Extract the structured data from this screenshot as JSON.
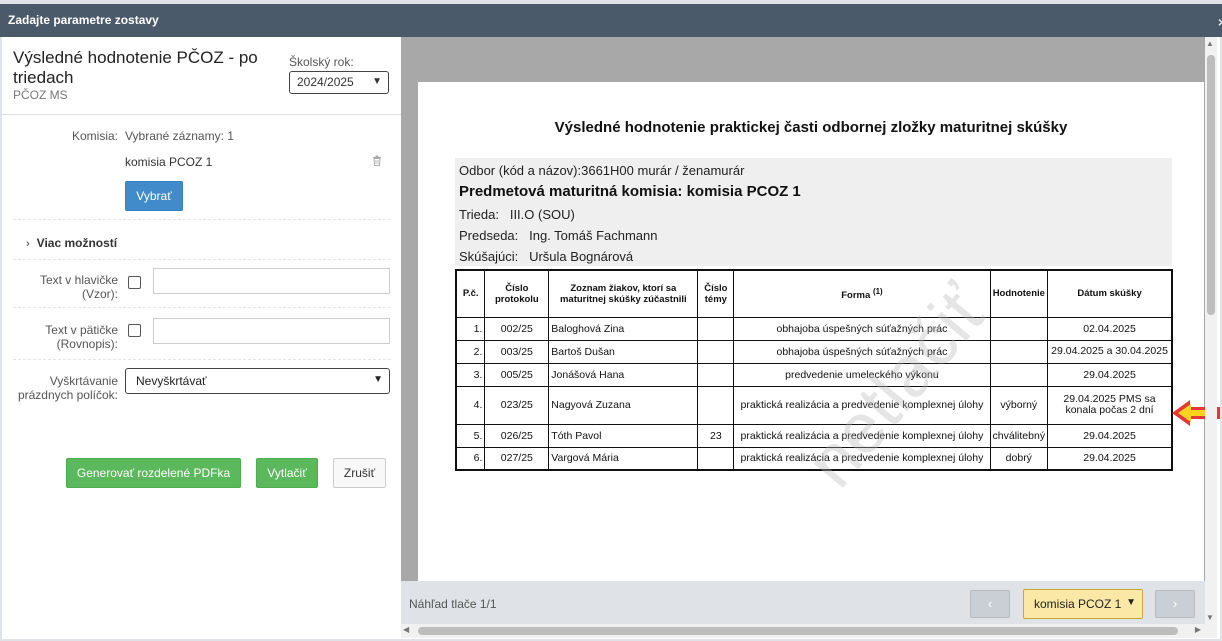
{
  "dialog": {
    "title": "Zadajte parametre zostavy",
    "close": "×"
  },
  "left": {
    "report_title": "Výsledné hodnotenie PČOZ - po triedach",
    "report_subtitle": "PČOZ MS",
    "year_label": "Školský rok:",
    "year_value": "2024/2025",
    "komisia_label": "Komisia:",
    "komisia_selected": "Vybrané záznamy: 1",
    "komisia_item": "komisia PCOZ 1",
    "vybrat_button": "Vybrať",
    "more_options": "Viac možností",
    "header_text_label": "Text v hlavičke (Vzor):",
    "footer_text_label": "Text v pätičke (Rovnopis):",
    "crossing_label": "Vyškrtávanie prázdnych políčok:",
    "crossing_value": "Nevyškrtávať",
    "generate_button": "Generovať rozdelené PDFka",
    "print_button": "Vytlačiť",
    "cancel_button": "Zrušiť"
  },
  "doc": {
    "title": "Výsledné hodnotenie praktickej časti odbornej zložky maturitnej skúšky",
    "odbor": "Odbor (kód a názov):3661H00 murár / ženamurár",
    "komisia": "Predmetová maturitná komisia: komisia PCOZ 1",
    "trieda_label": "Trieda:",
    "trieda_value": "III.O (SOU)",
    "predseda_label": "Predseda:",
    "predseda_value": "Ing. Tomáš Fachmann",
    "skusajuci_label": "Skúšajúci:",
    "skusajuci_value": "Uršula Bognárová",
    "headers": {
      "pc": "P.č.",
      "protokol": "Číslo protokolu",
      "zoznam": "Zoznam žiakov, ktorí sa maturitnej skúšky zúčastnili",
      "tema": "Číslo témy",
      "forma": "Forma",
      "forma_note": "(1)",
      "hodnotenie": "Hodnotenie",
      "datum": "Dátum skúšky"
    },
    "rows": [
      {
        "pc": "1.",
        "protokol": "002/25",
        "meno": "Baloghová Zina",
        "tema": "",
        "forma": "obhajoba úspešných súťažných prác",
        "hodnotenie": "",
        "datum": "02.04.2025"
      },
      {
        "pc": "2.",
        "protokol": "003/25",
        "meno": "Bartoš Dušan",
        "tema": "",
        "forma": "obhajoba úspešných súťažných prác",
        "hodnotenie": "",
        "datum": "29.04.2025 a 30.04.2025"
      },
      {
        "pc": "3.",
        "protokol": "005/25",
        "meno": "Jonášová Hana",
        "tema": "",
        "forma": "predvedenie umeleckého výkonu",
        "hodnotenie": "",
        "datum": "29.04.2025"
      },
      {
        "pc": "4.",
        "protokol": "023/25",
        "meno": "Nagyová Zuzana",
        "tema": "",
        "forma": "praktická realizácia a predvedenie komplexnej úlohy",
        "hodnotenie": "výborný",
        "datum": "29.04.2025 PMS sa konala počas 2 dní"
      },
      {
        "pc": "5.",
        "protokol": "026/25",
        "meno": "Tóth Pavol",
        "tema": "23",
        "forma": "praktická realizácia a predvedenie komplexnej úlohy",
        "hodnotenie": "chválitebný",
        "datum": "29.04.2025"
      },
      {
        "pc": "6.",
        "protokol": "027/25",
        "meno": "Vargová Mária",
        "tema": "",
        "forma": "praktická realizácia a predvedenie komplexnej úlohy",
        "hodnotenie": "dobrý",
        "datum": "29.04.2025"
      }
    ],
    "watermark": "netlačiť"
  },
  "footer": {
    "label": "Náhľad tlače 1/1",
    "prev": "‹",
    "next": "›",
    "komisia_value": "komisia PCOZ 1"
  },
  "colors": {
    "accent": "#428bca",
    "success": "#5cb85c",
    "titlebar": "#4a5a6a",
    "highlight": "#fbe8a6"
  }
}
